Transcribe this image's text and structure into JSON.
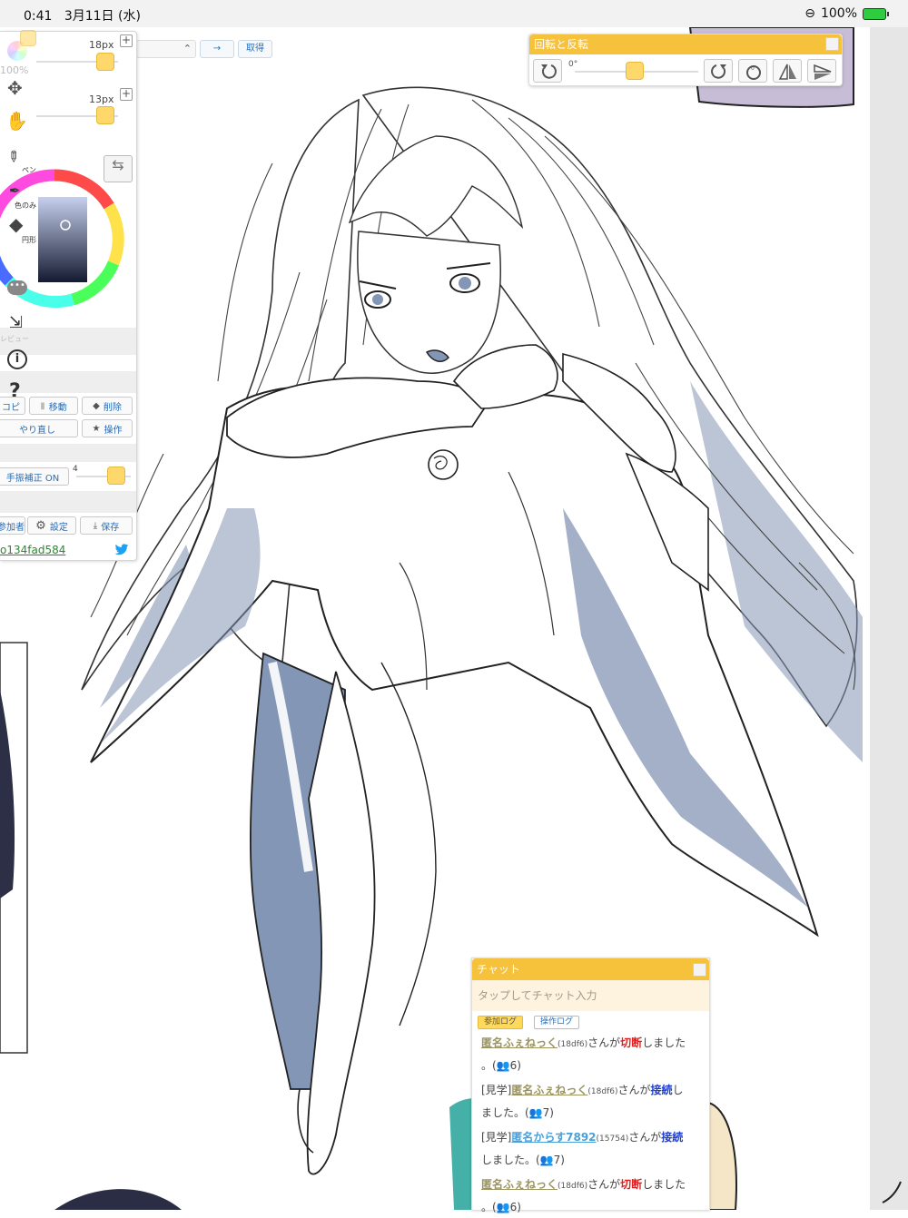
{
  "status_bar": {
    "time": "0:41",
    "date": "3月11日 (水)",
    "battery": "100%"
  },
  "tool_panel": {
    "brush_size": "18px",
    "eraser_size": "13px",
    "zoom": "100%",
    "tools": {
      "pen": "ペン",
      "color_only": "色のみ",
      "circle": "円形",
      "preview": "レビュー"
    },
    "buttons": {
      "copy": "コピ",
      "move": "移動",
      "delete": "削除",
      "redo": "やり直し",
      "operate": "操作",
      "stabilizer": "手振補正 ON",
      "participants": "参加者",
      "settings": "設定",
      "save": "保存"
    },
    "stabilizer_value": "4",
    "user_link": "o134fad584",
    "icons": [
      "move-arrows-icon",
      "hand-icon",
      "pen-icon",
      "eyedropper-icon",
      "diamond-icon",
      "chat-bubble-icon",
      "exit-icon",
      "info-icon",
      "help-icon",
      "undo-icon",
      "gear-icon",
      "download-icon",
      "twitter-icon"
    ],
    "accent_color": "#ffd86b"
  },
  "top_controls": {
    "select_value": "",
    "arrow_button": "→",
    "get_button": "取得"
  },
  "rotate_panel": {
    "title": "回転と反転",
    "angle": "0°",
    "header_color": "#f6c13b"
  },
  "chat": {
    "title": "チャット",
    "input_placeholder": "タップしてチャット入力",
    "tabs": {
      "join_log": "参加ログ",
      "op_log": "操作ログ"
    },
    "messages": [
      {
        "prefix": "",
        "user": "匿名ふぇねっく",
        "uid": "(18df6)",
        "mid": "さんが",
        "event": "切断",
        "rest": "しました",
        "line2": "。(",
        "count": "6",
        "end": ")"
      },
      {
        "prefix": "[見学]",
        "user": "匿名ふぇねっく",
        "uid": "(18df6)",
        "mid": "さんが",
        "event": "接続",
        "rest": "し",
        "line2": "ました。(",
        "count": "7",
        "end": ")"
      },
      {
        "prefix": "[見学]",
        "user": "匿名からす7892",
        "uid": "(15754)",
        "mid": "さんが",
        "event": "接続",
        "rest": "",
        "line2": "しました。(",
        "count": "7",
        "end": ")"
      },
      {
        "prefix": "",
        "user": "匿名ふぇねっく",
        "uid": "(18df6)",
        "mid": "さんが",
        "event": "切断",
        "rest": "しました",
        "line2": "。(",
        "count": "6",
        "end": ")"
      }
    ]
  }
}
